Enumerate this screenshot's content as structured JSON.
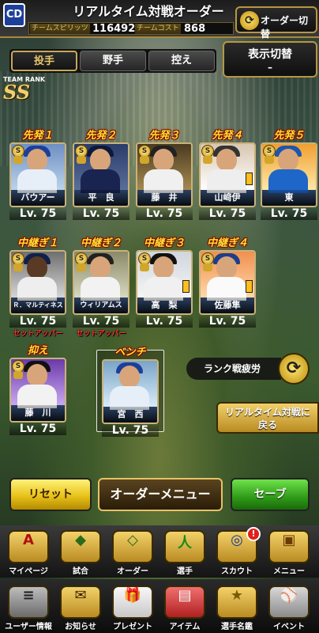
{
  "header": {
    "team_logo": "CD",
    "title": "リアルタイム対戦オーダー",
    "spirits_label": "チームスピリッツ",
    "spirits_value": "116492",
    "cost_label": "チームコスト",
    "cost_value": "868",
    "order_switch_label": "オーダー切替"
  },
  "tabs": [
    "投手",
    "野手",
    "控え"
  ],
  "active_tab": "投手",
  "display_switch": {
    "label": "表示切替",
    "value": "–"
  },
  "team_rank": {
    "label": "TEAM RANK",
    "value": "SS"
  },
  "starters": [
    {
      "slot": "先発１",
      "name": "バウアー",
      "level": "Lv. 75"
    },
    {
      "slot": "先発２",
      "name": "平　良",
      "level": "Lv. 75"
    },
    {
      "slot": "先発３",
      "name": "藤　井",
      "level": "Lv. 75"
    },
    {
      "slot": "先発４",
      "name": "山﨑伊",
      "level": "Lv. 75"
    },
    {
      "slot": "先発５",
      "name": "東",
      "level": "Lv. 75"
    }
  ],
  "relievers": [
    {
      "slot": "中継ぎ１",
      "name": "Ｒ．マルティネス",
      "level": "Lv. 75",
      "role": "セットアッパー"
    },
    {
      "slot": "中継ぎ２",
      "name": "ウィリアムス",
      "level": "Lv. 75",
      "role": "セットアッパー"
    },
    {
      "slot": "中継ぎ３",
      "name": "高　梨",
      "level": "Lv. 75",
      "role": ""
    },
    {
      "slot": "中継ぎ４",
      "name": "佐藤隼",
      "level": "Lv. 75",
      "role": ""
    }
  ],
  "closer": {
    "slot": "抑え",
    "name": "藤　川",
    "level": "Lv. 75"
  },
  "bench": {
    "slot": "ベンチ",
    "name": "宮　西",
    "level": "Lv. 75"
  },
  "rank_fatigue_label": "ランク戦疲労",
  "back_button_label": "リアルタイム対戦に\n戻る",
  "actions": {
    "reset": "リセット",
    "menu": "オーダーメニュー",
    "save": "セーブ"
  },
  "nav_primary": [
    {
      "label": "マイページ",
      "icon": "A"
    },
    {
      "label": "試合",
      "icon": "◆"
    },
    {
      "label": "オーダー",
      "icon": "◇"
    },
    {
      "label": "選手",
      "icon": "人"
    },
    {
      "label": "スカウト",
      "icon": "◎",
      "badge": "!"
    },
    {
      "label": "メニュー",
      "icon": "▣"
    }
  ],
  "nav_secondary": [
    {
      "label": "ユーザー情報",
      "icon": "≡"
    },
    {
      "label": "お知らせ",
      "icon": "✉"
    },
    {
      "label": "プレゼント",
      "icon": "🎁"
    },
    {
      "label": "アイテム",
      "icon": "▤"
    },
    {
      "label": "選手名鑑",
      "icon": "★"
    },
    {
      "label": "イベント",
      "icon": "⚾"
    }
  ],
  "colors": {
    "accent_gold": "#c7a85a",
    "slot_label": "#ffdd33",
    "role_red": "#ff3333",
    "save_green": "#2f9a18"
  }
}
